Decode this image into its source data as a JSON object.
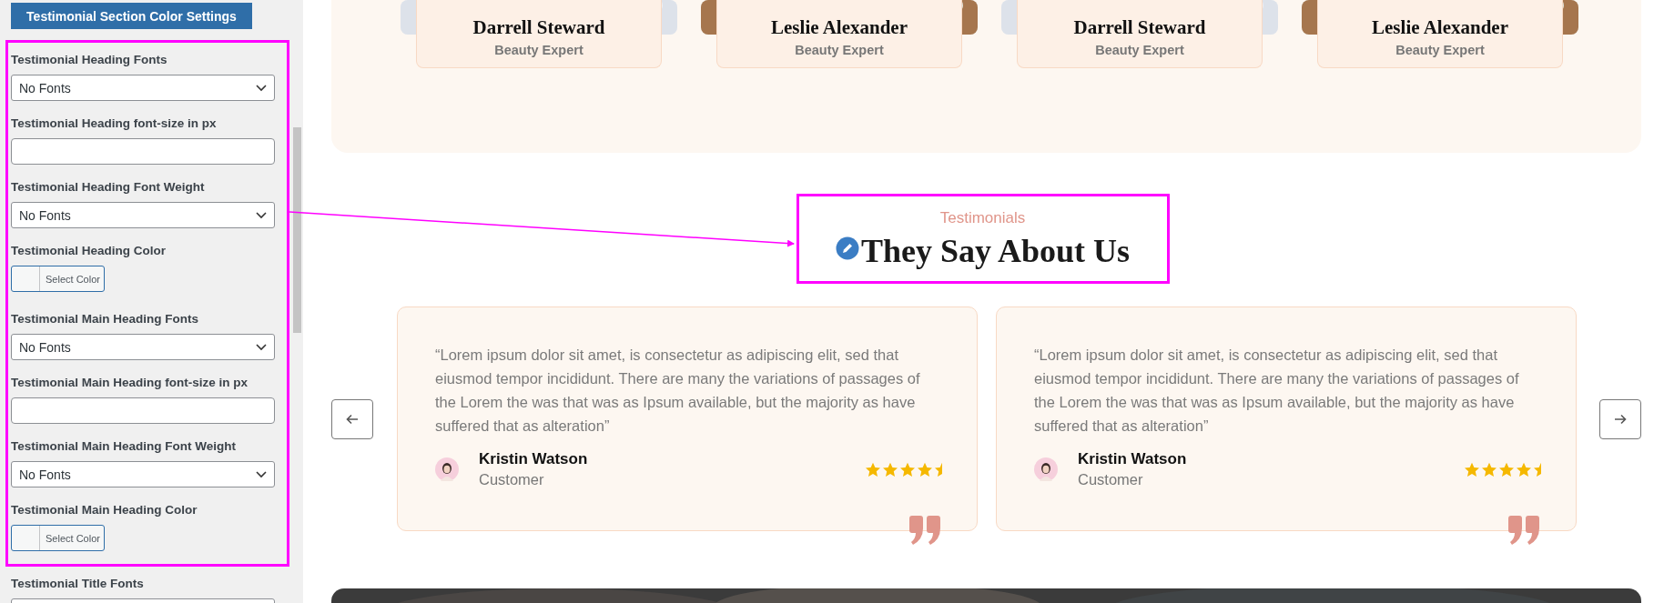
{
  "sidebar": {
    "header_button": "Testimonial Section Color Settings",
    "highlighted_fields": [
      {
        "kind": "select",
        "label": "Testimonial Heading Fonts",
        "value": "No Fonts"
      },
      {
        "kind": "text",
        "label": "Testimonial Heading font-size in px"
      },
      {
        "kind": "select",
        "label": "Testimonial Heading Font Weight",
        "value": "No Fonts"
      },
      {
        "kind": "color",
        "label": "Testimonial Heading Color",
        "button": "Select Color"
      },
      {
        "kind": "select",
        "label": "Testimonial Main Heading Fonts",
        "value": "No Fonts"
      },
      {
        "kind": "text",
        "label": "Testimonial Main Heading font-size in px"
      },
      {
        "kind": "select",
        "label": "Testimonial Main Heading Font Weight",
        "value": "No Fonts"
      },
      {
        "kind": "color",
        "label": "Testimonial Main Heading Color",
        "button": "Select Color"
      }
    ],
    "fields_below": [
      {
        "kind": "select",
        "label": "Testimonial Title Fonts"
      }
    ]
  },
  "team_cards": [
    {
      "name": "Darrell Steward",
      "role": "Beauty Expert"
    },
    {
      "name": "Leslie Alexander",
      "role": "Beauty Expert"
    },
    {
      "name": "Darrell Steward",
      "role": "Beauty Expert"
    },
    {
      "name": "Leslie Alexander",
      "role": "Beauty Expert"
    }
  ],
  "testimonial_section": {
    "subtitle": "Testimonials",
    "heading": "They Say About Us",
    "testimonials": [
      {
        "quote": "“Lorem ipsum dolor sit amet, is consectetur as adipiscing elit, sed that eiusmod tempor incididunt. There are many the variations of passages of the Lorem the was that was as Ipsum available, but the majority as have suffered that as alteration”",
        "name": "Kristin Watson",
        "role": "Customer",
        "stars": 4.5
      },
      {
        "quote": "“Lorem ipsum dolor sit amet, is consectetur as adipiscing elit, sed that eiusmod tempor incididunt. There are many the variations of passages of the Lorem the was that was as Ipsum available, but the majority as have suffered that as alteration”",
        "name": "Kristin Watson",
        "role": "Customer",
        "stars": 4.5
      }
    ]
  }
}
